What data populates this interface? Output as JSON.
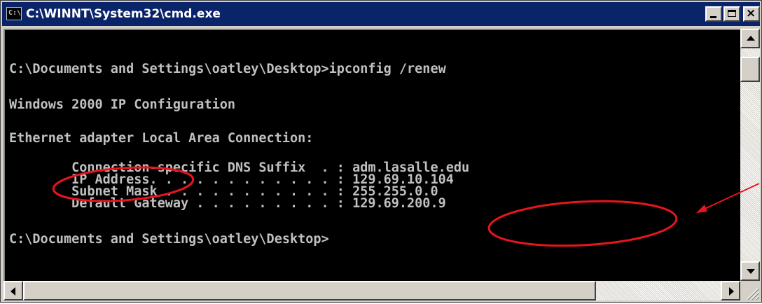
{
  "window": {
    "title": "C:\\WINNT\\System32\\cmd.exe",
    "icon": "cmd-console-icon",
    "icon_glyph": "C:\\",
    "controls": {
      "minimize": "minimize-icon",
      "maximize": "maximize-icon",
      "close": "close-icon",
      "close_glyph": "×"
    }
  },
  "console": {
    "lines": [
      "C:\\Documents and Settings\\oatley\\Desktop>ipconfig /renew",
      "Windows 2000 IP Configuration",
      "Ethernet adapter Local Area Connection:",
      "        Connection-specific DNS Suffix  . : adm.lasalle.edu",
      "        IP Address. . . . . . . . . . . . : 129.69.10.104",
      "        Subnet Mask . . . . . . . . . . . : 255.255.0.0",
      "        Default Gateway . . . . . . . . . : 129.69.200.9",
      "C:\\Documents and Settings\\oatley\\Desktop>"
    ]
  },
  "annotations": {
    "color": "#e8141e",
    "circled": [
      "IP Address",
      "129.69.200.9"
    ],
    "arrow": "points to Default Gateway value"
  },
  "colors": {
    "console_bg": "#000000",
    "console_text": "#c0c0c0",
    "titlebar": "#0a246a",
    "title_text": "#ffffff",
    "chrome": "#d4d0c8"
  }
}
